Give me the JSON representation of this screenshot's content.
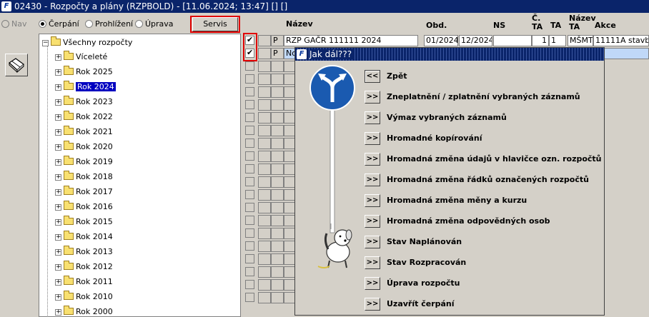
{
  "window": {
    "title": "02430 - Rozpočty a plány (RZPBOLD) - [11.06.2024; 13:47]  [] []"
  },
  "modes": {
    "nav": "Nav",
    "cerpani": "Čerpání",
    "prohlizeni": "Prohlížení",
    "uprava": "Úprava",
    "selected": "Čerpání"
  },
  "servis_label": "Servis",
  "tree": {
    "root": "Všechny rozpočty",
    "items": [
      "Víceleté",
      "Rok 2025",
      "Rok 2024",
      "Rok 2023",
      "Rok 2022",
      "Rok 2021",
      "Rok 2020",
      "Rok 2019",
      "Rok 2018",
      "Rok 2017",
      "Rok 2016",
      "Rok 2015",
      "Rok 2014",
      "Rok 2013",
      "Rok 2012",
      "Rok 2011",
      "Rok 2010",
      "Rok 2000"
    ],
    "selected": "Rok 2024"
  },
  "grid": {
    "headers": {
      "nazev": "Název",
      "obd": "Obd.",
      "ns": "NS",
      "c_ta": "Č. TA",
      "ta": "TA",
      "nazev_ta": "Název TA",
      "akce": "Akce"
    },
    "rows": [
      {
        "p": "P",
        "nazev": "RZP GAČR 111111 2024",
        "od": "01/2024",
        "do": "12/2024",
        "ns": "",
        "c_ta": "1",
        "ta": "1",
        "nazev_ta": "MŠMT",
        "akce": "11111A stavba",
        "checked": true
      },
      {
        "p": "P",
        "nazev": "No",
        "checked": true
      }
    ]
  },
  "dialog": {
    "title": "Jak dál???",
    "back_glyph": "<<",
    "go_glyph": ">>",
    "items": [
      "Zpět",
      "Zneplatnění / zplatnění vybraných záznamů",
      "Výmaz vybraných záznamů",
      "Hromadné kopírování",
      "Hromadná změna údajů v hlavičce ozn. rozpočtů",
      "Hromadná změna řádků označených rozpočtů",
      "Hromadná změna měny a kurzu",
      "Hromadná změna odpovědných osob",
      "Stav Naplánován",
      "Stav Rozpracován",
      "Úprava rozpočtu",
      "Uzavřít čerpání"
    ]
  },
  "icons": {
    "app_logo": "app-logo-icon",
    "tool": "eraser-hand-icon",
    "sign": "direction-sign-icon",
    "dog": "dog-icon"
  },
  "colors": {
    "titlebar": "#0a246a",
    "highlight_outline": "#e00000",
    "tree_selection": "#0000c0",
    "sign_blue": "#1a5ab0"
  }
}
